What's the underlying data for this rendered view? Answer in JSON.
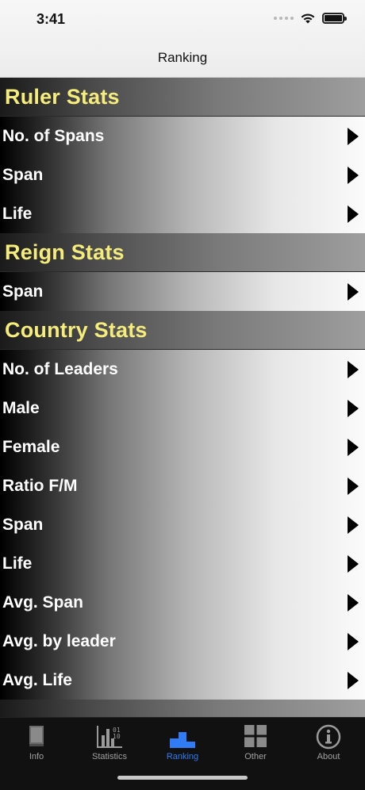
{
  "status": {
    "time": "3:41"
  },
  "nav": {
    "title": "Ranking"
  },
  "sections": [
    {
      "title": "Ruler Stats",
      "items": [
        "No. of Spans",
        "Span",
        "Life"
      ]
    },
    {
      "title": "Reign Stats",
      "items": [
        "Span"
      ]
    },
    {
      "title": "Country Stats",
      "items": [
        "No. of Leaders",
        "Male",
        "Female",
        "Ratio F/M",
        "Span",
        "Life",
        "Avg. Span",
        "Avg. by leader",
        "Avg. Life"
      ]
    }
  ],
  "tabs": [
    {
      "label": "Info",
      "icon": "book-icon"
    },
    {
      "label": "Statistics",
      "icon": "statistics-icon"
    },
    {
      "label": "Ranking",
      "icon": "ranking-icon",
      "active": true
    },
    {
      "label": "Other",
      "icon": "grid-icon"
    },
    {
      "label": "About",
      "icon": "info-icon"
    }
  ],
  "colors": {
    "header_text": "#f5ec7c",
    "active_tab": "#2f7cf6"
  }
}
